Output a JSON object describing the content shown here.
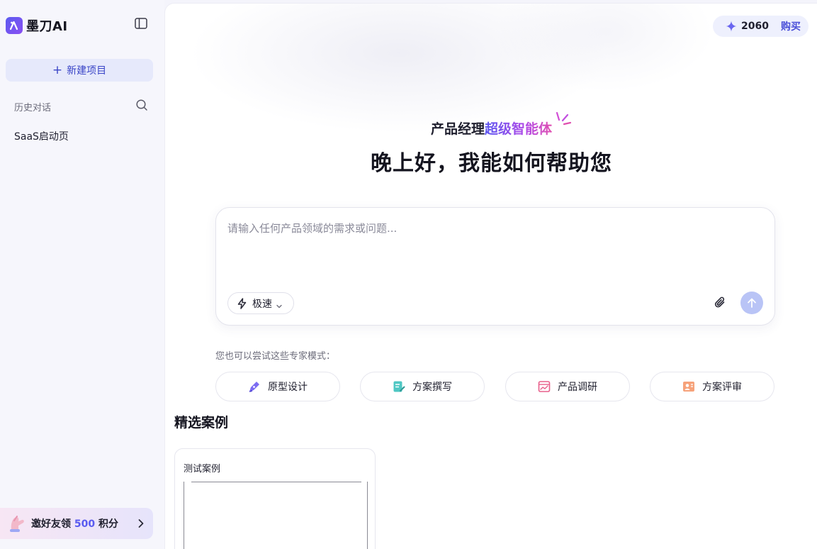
{
  "app": {
    "logo_text": "墨刀AI",
    "brand_color": "#5b5bf0"
  },
  "sidebar": {
    "new_project_label": "新建项目",
    "history_title": "历史对话",
    "history_items": [
      {
        "label": "SaaS启动页"
      }
    ],
    "invite": {
      "prefix": "邀好友领",
      "points": "500",
      "suffix": "积分"
    }
  },
  "header": {
    "credits_count": "2060",
    "buy_label": "购买"
  },
  "hero": {
    "subtitle_plain": "产品经理",
    "subtitle_highlight": "超级智能体",
    "greeting": "晚上好，我能如何帮助您"
  },
  "composer": {
    "placeholder": "请输入任何产品领域的需求或问题...",
    "mode_label": "极速",
    "send_disabled": true
  },
  "experts": {
    "label": "您也可以尝试这些专家模式：",
    "items": [
      {
        "label": "原型设计",
        "icon": "pen-icon"
      },
      {
        "label": "方案撰写",
        "icon": "doc-edit-icon"
      },
      {
        "label": "产品调研",
        "icon": "chart-window-icon"
      },
      {
        "label": "方案评审",
        "icon": "review-icon"
      }
    ]
  },
  "cases": {
    "title": "精选案例",
    "items": [
      {
        "title": "测试案例"
      }
    ]
  }
}
